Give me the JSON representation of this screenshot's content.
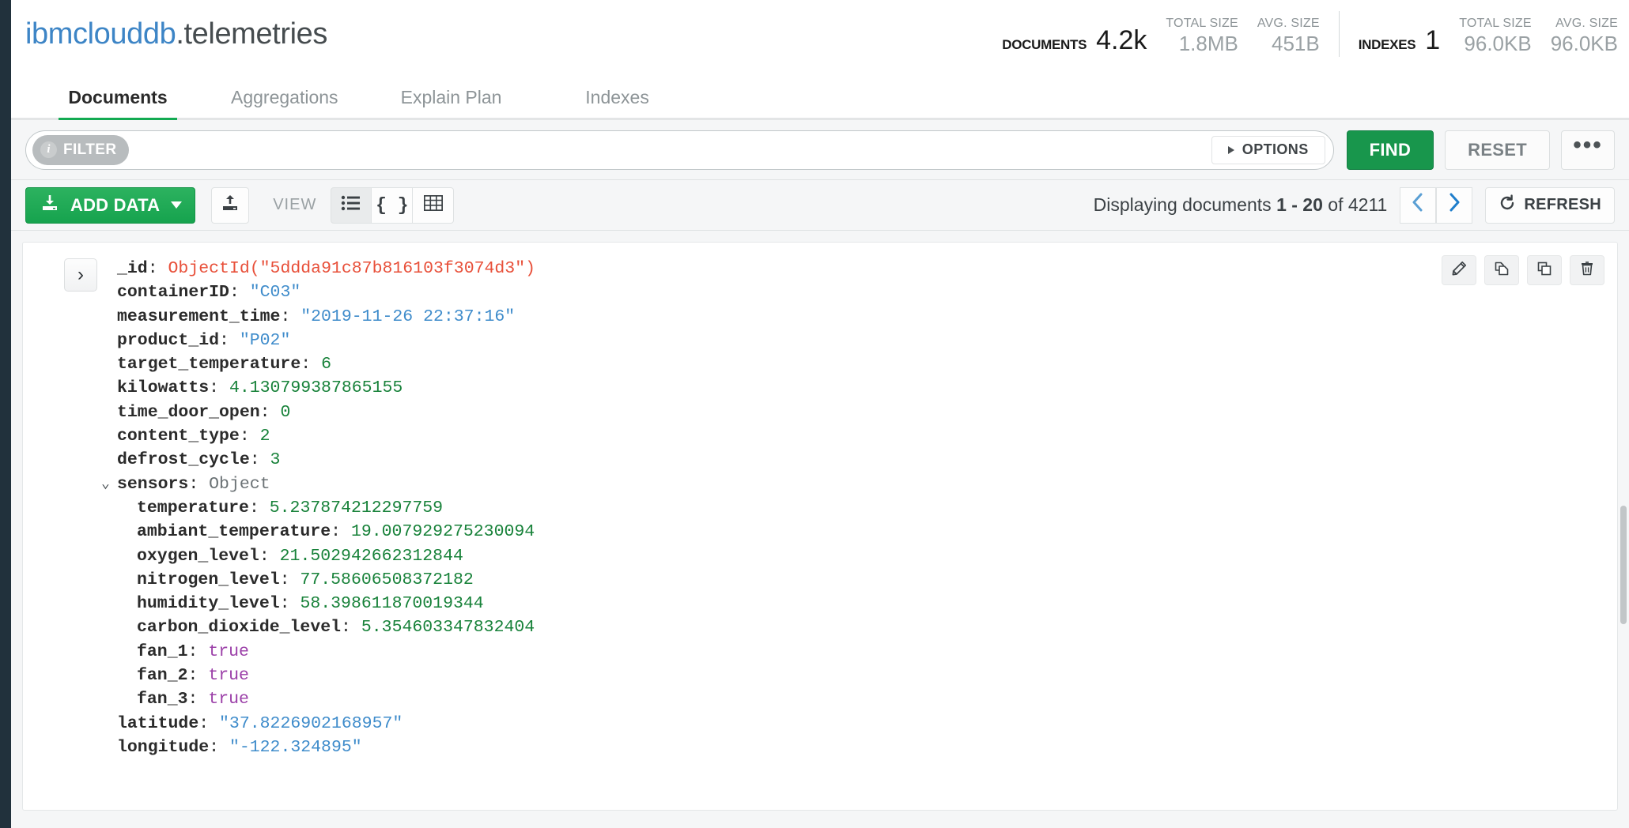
{
  "header": {
    "database": "ibmclouddb",
    "separator": ".",
    "collection": "telemetries",
    "stats": {
      "documents": {
        "label": "DOCUMENTS",
        "value": "4.2k"
      },
      "documents_total_size": {
        "label": "TOTAL SIZE",
        "value": "1.8MB"
      },
      "documents_avg_size": {
        "label": "AVG. SIZE",
        "value": "451B"
      },
      "indexes": {
        "label": "INDEXES",
        "value": "1"
      },
      "indexes_total_size": {
        "label": "TOTAL SIZE",
        "value": "96.0KB"
      },
      "indexes_avg_size": {
        "label": "AVG. SIZE",
        "value": "96.0KB"
      }
    }
  },
  "tabs": [
    {
      "label": "Documents",
      "active": true
    },
    {
      "label": "Aggregations",
      "active": false
    },
    {
      "label": "Explain Plan",
      "active": false
    },
    {
      "label": "Indexes",
      "active": false
    }
  ],
  "querybar": {
    "filter_label": "FILTER",
    "filter_value": "",
    "filter_placeholder": "",
    "options_label": "OPTIONS",
    "find_label": "FIND",
    "reset_label": "RESET",
    "more_label": "•••"
  },
  "toolbar": {
    "add_data_label": "ADD DATA",
    "view_label": "VIEW",
    "view_modes": [
      {
        "name": "list",
        "glyph": "☰",
        "active": true
      },
      {
        "name": "json",
        "glyph": "{ }",
        "active": false
      },
      {
        "name": "table",
        "glyph": "▦",
        "active": false
      }
    ],
    "displaying_prefix": "Displaying documents ",
    "displaying_range": "1 - 20",
    "displaying_middle": " of ",
    "displaying_total": "4211",
    "refresh_label": "REFRESH"
  },
  "document": {
    "fields": [
      {
        "name": "_id",
        "value": "ObjectId(\"5ddda91c87b816103f3074d3\")",
        "type": "objectid",
        "nested": false,
        "expandable": false
      },
      {
        "name": "containerID",
        "value": "\"C03\"",
        "type": "string",
        "nested": false,
        "expandable": false
      },
      {
        "name": "measurement_time",
        "value": "\"2019-11-26 22:37:16\"",
        "type": "string",
        "nested": false,
        "expandable": false
      },
      {
        "name": "product_id",
        "value": "\"P02\"",
        "type": "string",
        "nested": false,
        "expandable": false
      },
      {
        "name": "target_temperature",
        "value": "6",
        "type": "number",
        "nested": false,
        "expandable": false
      },
      {
        "name": "kilowatts",
        "value": "4.130799387865155",
        "type": "number",
        "nested": false,
        "expandable": false
      },
      {
        "name": "time_door_open",
        "value": "0",
        "type": "number",
        "nested": false,
        "expandable": false
      },
      {
        "name": "content_type",
        "value": "2",
        "type": "number",
        "nested": false,
        "expandable": false
      },
      {
        "name": "defrost_cycle",
        "value": "3",
        "type": "number",
        "nested": false,
        "expandable": false
      },
      {
        "name": "sensors",
        "value": "Object",
        "type": "type",
        "nested": false,
        "expandable": true
      },
      {
        "name": "temperature",
        "value": "5.237874212297759",
        "type": "number",
        "nested": true,
        "expandable": false
      },
      {
        "name": "ambiant_temperature",
        "value": "19.007929275230094",
        "type": "number",
        "nested": true,
        "expandable": false
      },
      {
        "name": "oxygen_level",
        "value": "21.502942662312844",
        "type": "number",
        "nested": true,
        "expandable": false
      },
      {
        "name": "nitrogen_level",
        "value": "77.58606508372182",
        "type": "number",
        "nested": true,
        "expandable": false
      },
      {
        "name": "humidity_level",
        "value": "58.398611870019344",
        "type": "number",
        "nested": true,
        "expandable": false
      },
      {
        "name": "carbon_dioxide_level",
        "value": "5.354603347832404",
        "type": "number",
        "nested": true,
        "expandable": false
      },
      {
        "name": "fan_1",
        "value": "true",
        "type": "bool",
        "nested": true,
        "expandable": false
      },
      {
        "name": "fan_2",
        "value": "true",
        "type": "bool",
        "nested": true,
        "expandable": false
      },
      {
        "name": "fan_3",
        "value": "true",
        "type": "bool",
        "nested": true,
        "expandable": false
      },
      {
        "name": "latitude",
        "value": "\"37.8226902168957\"",
        "type": "string",
        "nested": false,
        "expandable": false
      },
      {
        "name": "longitude",
        "value": "\"-122.324895\"",
        "type": "string",
        "nested": false,
        "expandable": false
      }
    ],
    "expand_glyph": "›",
    "collapse_glyph": "⌄"
  },
  "colors": {
    "brand_green": "#13aa52",
    "find_green": "#18964c",
    "db_blue": "#3d85c6",
    "objectid_red": "#e8503a",
    "string_blue": "#3f8ccb",
    "number_green": "#18823a",
    "bool_purple": "#9b3fa8",
    "rail_dark": "#21313c"
  }
}
